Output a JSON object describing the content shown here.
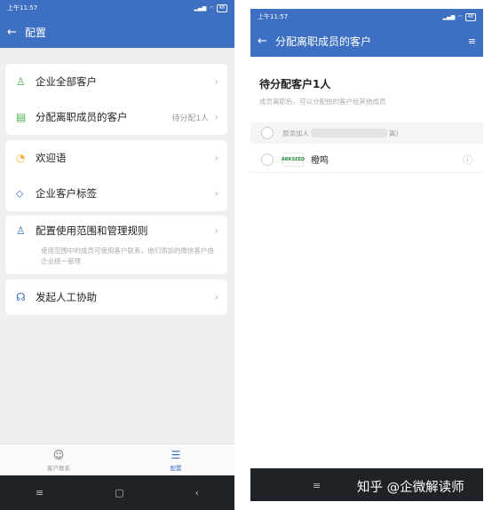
{
  "left": {
    "status": {
      "time": "上午11:57",
      "battery": "48"
    },
    "appbar": {
      "title": "配置"
    },
    "menu": {
      "all_customers": "企业全部客户",
      "assign_departed": "分配离职成员的客户",
      "assign_departed_value": "待分配1人",
      "welcome": "欢迎语",
      "tags": "企业客户标签",
      "config_scope": "配置使用范围和管理规则",
      "config_scope_desc": "使用范围中的成员可使用客户联系，他们添加的微信客户由企业统一管理",
      "manual_help": "发起人工协助"
    },
    "tabs": {
      "contacts": "客户联系",
      "config": "配置"
    }
  },
  "right": {
    "status": {
      "time": "上午11:57",
      "battery": "48"
    },
    "appbar": {
      "title": "分配离职成员的客户"
    },
    "heading": "待分配客户1人",
    "subtext": "成员离职后，可以分配他的客户给其他成员",
    "group_prefix": "原添加人",
    "group_suffix": "离)",
    "member": {
      "logo_text": "ARKSEED",
      "name": "橙鸣"
    }
  },
  "watermark": "知乎 @企微解读师"
}
